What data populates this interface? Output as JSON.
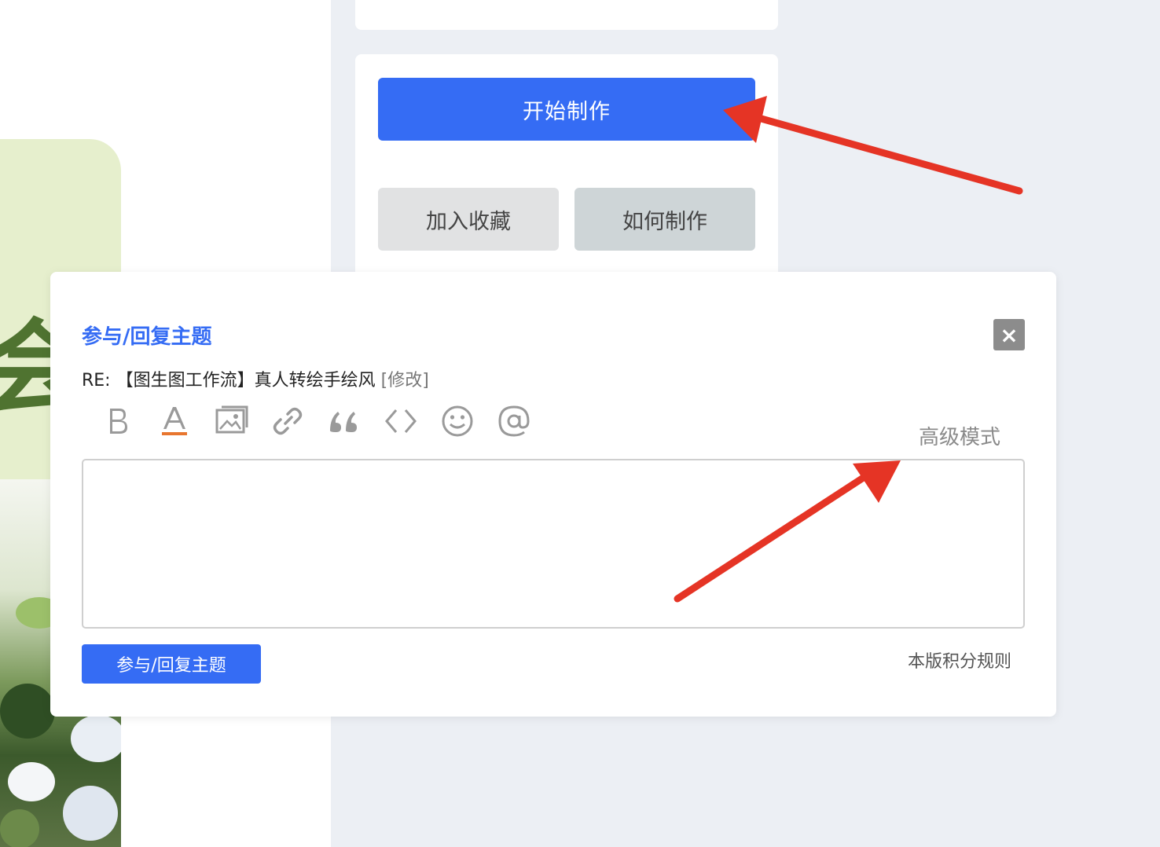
{
  "background": {
    "banner_glyph": "会"
  },
  "actions": {
    "start_label": "开始制作",
    "favorite_label": "加入收藏",
    "howto_label": "如何制作"
  },
  "dialog": {
    "title": "参与/回复主题",
    "close_icon": "×",
    "subject_prefix": "RE: ",
    "subject": "【图生图工作流】真人转绘手绘风",
    "edit_link": "[修改]",
    "toolbar": [
      "bold-icon",
      "font-color-icon",
      "image-icon",
      "link-icon",
      "quote-icon",
      "code-icon",
      "emoji-icon",
      "mention-icon"
    ],
    "advanced_mode": "高级模式",
    "editor_value": "",
    "submit_label": "参与/回复主题",
    "rules_link": "本版积分规则"
  },
  "colors": {
    "primary": "#356cf4",
    "annotation_arrow": "#e53425",
    "page_bg": "#eceff4"
  }
}
